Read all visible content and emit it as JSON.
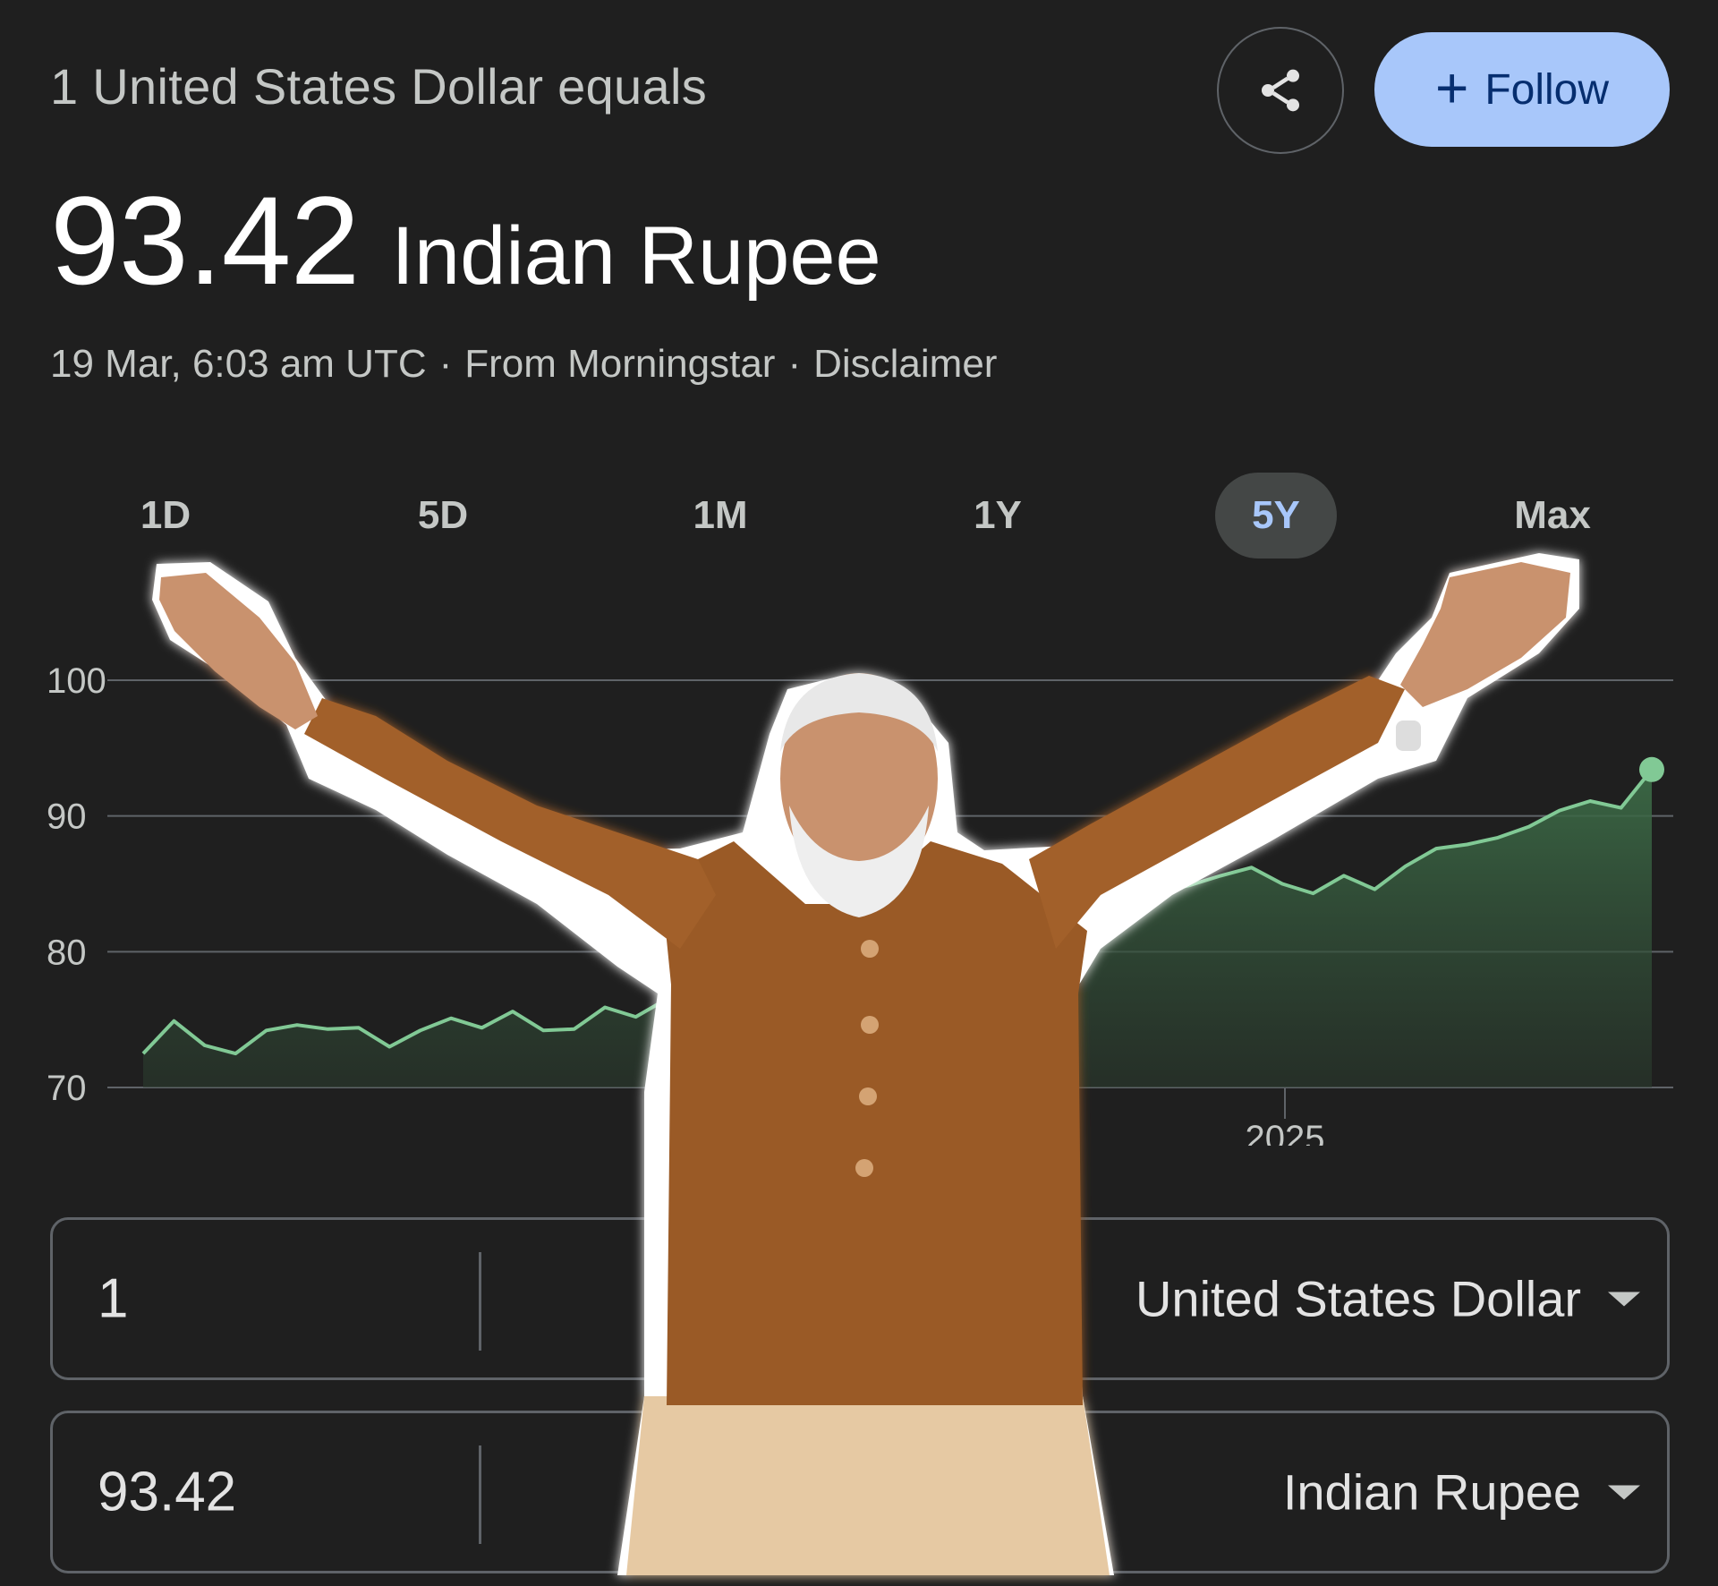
{
  "header": {
    "conversion_prefix": "1 United States Dollar equals",
    "rate_value": "93.42",
    "target_currency": "Indian Rupee",
    "timestamp": "19 Mar, 6:03 am UTC",
    "separator": "·",
    "source": "From Morningstar",
    "disclaimer": "Disclaimer"
  },
  "actions": {
    "share_icon": "share-icon",
    "follow_label": "Follow",
    "follow_icon": "plus-icon"
  },
  "range_tabs": [
    {
      "label": "1D",
      "active": false
    },
    {
      "label": "5D",
      "active": false
    },
    {
      "label": "1M",
      "active": false
    },
    {
      "label": "1Y",
      "active": false
    },
    {
      "label": "5Y",
      "active": true
    },
    {
      "label": "Max",
      "active": false
    }
  ],
  "chart_data": {
    "type": "area",
    "y_ticks": [
      "100",
      "90",
      "80",
      "70"
    ],
    "x_ticks": [
      "2025"
    ],
    "ylim": [
      70,
      100
    ],
    "grid": true,
    "line_color": "#81c995",
    "series": [
      {
        "values": [
          72.5,
          74.9,
          73.1,
          72.5,
          74.2,
          74.6,
          74.3,
          74.4,
          73.0,
          74.2,
          75.1,
          74.4,
          75.6,
          74.2,
          74.3,
          75.9,
          75.2,
          76.5,
          77.4,
          78.7,
          79.9,
          81.3,
          82.5,
          83.1,
          82.8,
          83.0,
          83.2,
          83.5,
          83.4,
          83.6,
          83.5,
          83.8,
          84.0,
          84.4,
          84.9,
          85.6,
          86.2,
          85.0,
          84.3,
          85.6,
          84.6,
          86.3,
          87.6,
          87.9,
          88.4,
          89.2,
          90.4,
          91.1,
          90.6,
          93.42
        ]
      }
    ]
  },
  "converter": {
    "from_amount": "1",
    "from_currency": "United States Dollar",
    "to_amount": "93.42",
    "to_currency": "Indian Rupee"
  },
  "overlay": {
    "subject": "photo-cutout-person-arms-raised",
    "jacket_color": "#9a5a26",
    "trouser_color": "#e6c9a3",
    "skin_color": "#c9926e",
    "hair_color": "#e8e8e8"
  }
}
